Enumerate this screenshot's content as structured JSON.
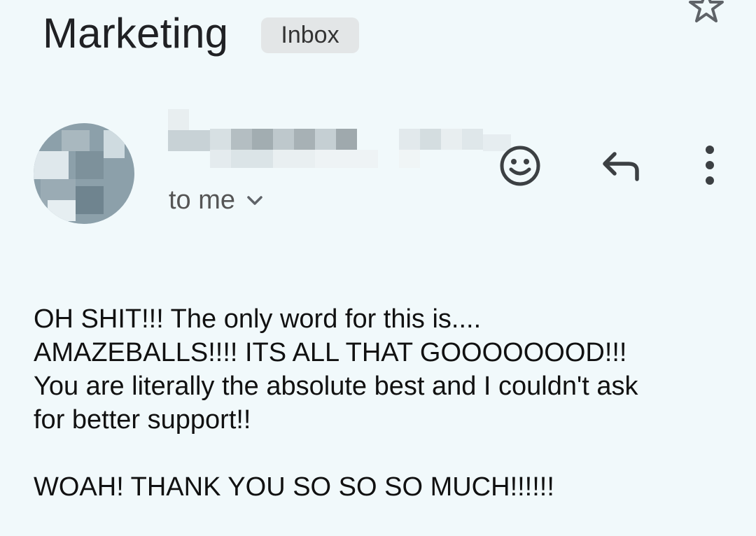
{
  "email": {
    "subject": "Marketing",
    "label": "Inbox",
    "recipient": "to me",
    "body_lines": [
      "OH SHIT!!! The only word for this is....",
      "AMAZEBALLS!!!! ITS ALL THAT GOOOOOOOD!!!",
      "You are literally the absolute best and I couldn't ask",
      "for better support!!",
      "",
      "WOAH! THANK YOU SO SO SO MUCH!!!!!!"
    ]
  },
  "icons": {
    "star": "star-icon",
    "emoji": "emoji-icon",
    "reply": "reply-icon",
    "more": "more-vertical-icon",
    "chevron": "chevron-down-icon"
  },
  "colors": {
    "background": "#f1f9fb",
    "label_chip": "#e3e6e7",
    "icon": "#3c4043",
    "avatar": "#8ca0aa"
  }
}
